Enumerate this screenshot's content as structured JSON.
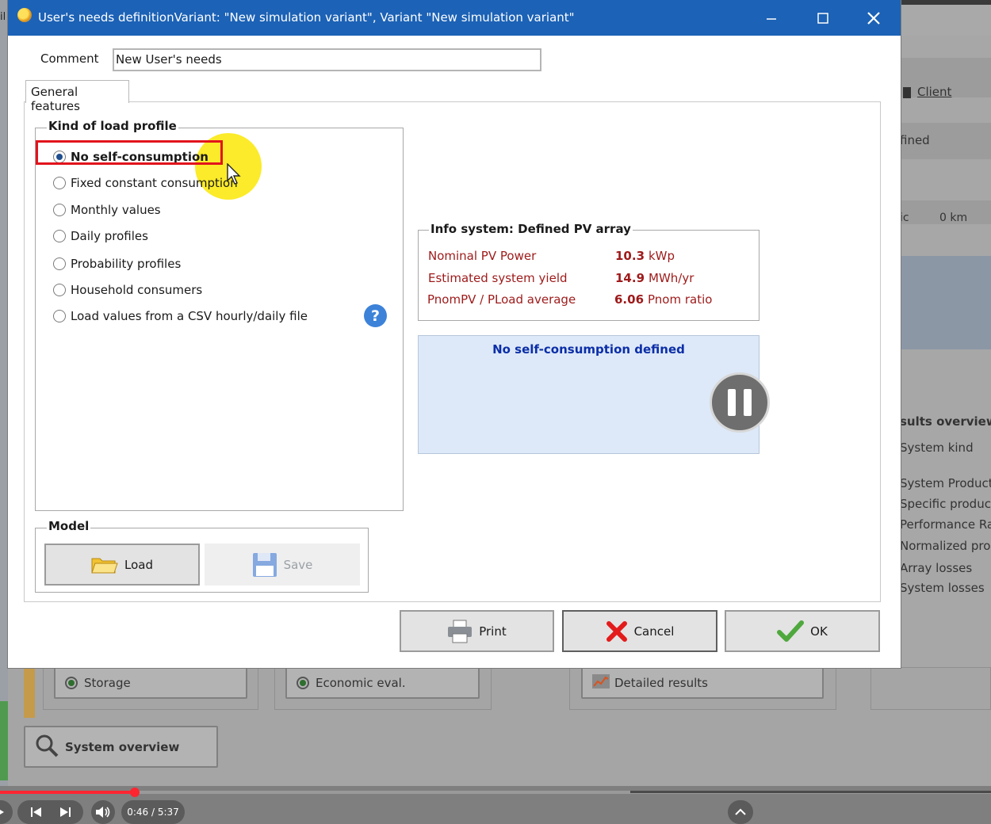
{
  "background": {
    "left_caption": "il",
    "right_panel": {
      "client_label": "Client",
      "defined_label": "fined",
      "distance_prefix": "ic",
      "distance_value": "0 km",
      "results_heading": "sults overview",
      "results_items": [
        "System kind",
        "System Productio",
        "Specific productio",
        "Performance Rat",
        "Normalized produ",
        "Array losses",
        "System losses"
      ]
    },
    "bottom_buttons": {
      "storage": "Storage",
      "economic": "Economic eval.",
      "detailed": "Detailed results",
      "system_overview": "System overview"
    }
  },
  "dialog": {
    "title": "User's needs definitionVariant:  \"New simulation variant\", Variant  \"New simulation variant\"",
    "comment_label": "Comment",
    "comment_value": "New User's needs",
    "tab_label": "General features",
    "load_profile": {
      "title": "Kind of load profile",
      "selected_index": 0,
      "options": [
        "No self-consumption",
        "Fixed constant consumption",
        "Monthly values",
        "Daily profiles",
        "Probability profiles",
        "Household consumers",
        "Load values from a CSV hourly/daily file"
      ]
    },
    "help_icon_glyph": "?",
    "info_system": {
      "title": "Info system: Defined PV array",
      "rows": [
        {
          "label": "Nominal PV Power",
          "value": "10.3",
          "unit": "kWp"
        },
        {
          "label": "Estimated system yield",
          "value": "14.9",
          "unit": "MWh/yr"
        },
        {
          "label": "PnomPV / PLoad average",
          "value": "6.06",
          "unit": "Pnom ratio"
        }
      ]
    },
    "message": "No self-consumption defined",
    "model": {
      "title": "Model",
      "load_label": "Load",
      "save_label": "Save"
    },
    "buttons": {
      "print": "Print",
      "cancel": "Cancel",
      "ok": "OK"
    }
  },
  "player": {
    "time": "0:46 / 5:37",
    "progress": 0.136
  },
  "colors": {
    "titlebar": "#1c62b6",
    "info_text": "#9e1a1a",
    "message_text": "#0b2ea8",
    "highlight": "#e1141c",
    "progress": "#ff2530"
  }
}
